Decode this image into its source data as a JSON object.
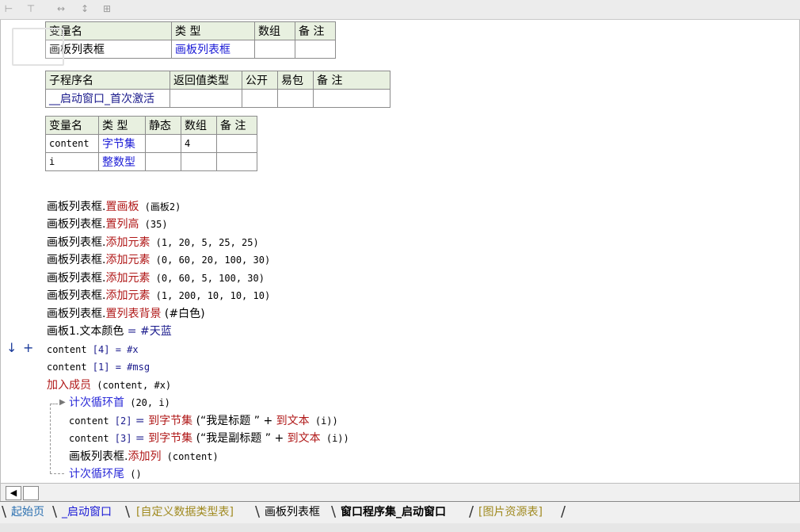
{
  "toolbar": {
    "buttons": [
      {
        "icon": "align-left-icon",
        "glyph": "⊢"
      },
      {
        "icon": "align-top-icon",
        "glyph": "⊤"
      },
      {
        "icon": "same-width-icon",
        "glyph": "↔"
      },
      {
        "icon": "same-height-icon",
        "glyph": "↕"
      },
      {
        "icon": "same-size-icon",
        "glyph": "⊞"
      }
    ]
  },
  "var_table": {
    "headers": [
      "变量名",
      "类 型",
      "数组",
      "备 注"
    ],
    "rows": [
      [
        "画板列表框",
        "画板列表框",
        "",
        ""
      ]
    ]
  },
  "sub_table": {
    "headers": [
      "子程序名",
      "返回值类型",
      "公开",
      "易包",
      "备 注"
    ],
    "rows": [
      [
        "__启动窗口_首次激活",
        "",
        "",
        "",
        ""
      ]
    ]
  },
  "local_table": {
    "headers": [
      "变量名",
      "类 型",
      "静态",
      "数组",
      "备 注"
    ],
    "rows": [
      [
        "content",
        "字节集",
        "",
        "4",
        ""
      ],
      [
        "i",
        "整数型",
        "",
        "",
        ""
      ]
    ]
  },
  "code": {
    "lines": [
      {
        "obj": "画板列表框.",
        "method": "置画板",
        "args": " (画板2)"
      },
      {
        "obj": "画板列表框.",
        "method": "置列高",
        "args": " (35)"
      },
      {
        "obj": "画板列表框.",
        "method": "添加元素",
        "args": " (1, 20, 5, 25, 25)"
      },
      {
        "obj": "画板列表框.",
        "method": "添加元素",
        "args": " (0, 60, 20, 100, 30)"
      },
      {
        "obj": "画板列表框.",
        "method": "添加元素",
        "args": " (0, 60, 5, 100, 30)"
      },
      {
        "obj": "画板列表框.",
        "method": "添加元素",
        "args": " (1, 200, 10, 10, 10)"
      },
      {
        "obj": "画板列表框.",
        "method": "置列表背景",
        "args": " (#白色)"
      }
    ],
    "assign_color": {
      "left": "画板1.文本颜色",
      "op": " = ",
      "right": "#天蓝"
    },
    "content4": {
      "left": "content ",
      "idx": "[4]",
      "op": " = ",
      "right": "#x"
    },
    "content1": {
      "left": "content ",
      "idx": "[1]",
      "op": " = ",
      "right": "#msg"
    },
    "add_member": {
      "cmd": "加入成员",
      "args": " (content, #x)"
    },
    "loop_head": {
      "cmd": "计次循环首",
      "args": " (20, i)"
    },
    "loop_l1": {
      "left": "content ",
      "idx": "[2]",
      "op": " = ",
      "fn": "到字节集",
      "p1": " (“我是标题 ” + ",
      "fn2": "到文本",
      "p2": " (i))"
    },
    "loop_l2": {
      "left": "content ",
      "idx": "[3]",
      "op": " = ",
      "fn": "到字节集",
      "p1": " (“我是副标题 ” + ",
      "fn2": "到文本",
      "p2": " (i))"
    },
    "loop_l3": {
      "obj": "画板列表框.",
      "method": "添加列",
      "args": " (content)"
    },
    "loop_tail": {
      "cmd": "计次循环尾",
      "args": " ()"
    },
    "markers": {
      "down": "↓",
      "plus": "+"
    }
  },
  "tabs": [
    {
      "label": "起始页",
      "color": "#2a6fb0",
      "bold": false
    },
    {
      "label": "_启动窗口",
      "color": "#1a1ad6",
      "bold": false
    },
    {
      "label": "[自定义数据类型表]",
      "color": "#a08a20",
      "bold": false
    },
    {
      "label": "画板列表框",
      "color": "#000000",
      "bold": false
    },
    {
      "label": "窗口程序集_启动窗口",
      "color": "#000000",
      "bold": true
    },
    {
      "label": "[图片资源表]",
      "color": "#a08a20",
      "bold": false
    }
  ],
  "hscroll": {
    "left_arrow": "◀"
  }
}
